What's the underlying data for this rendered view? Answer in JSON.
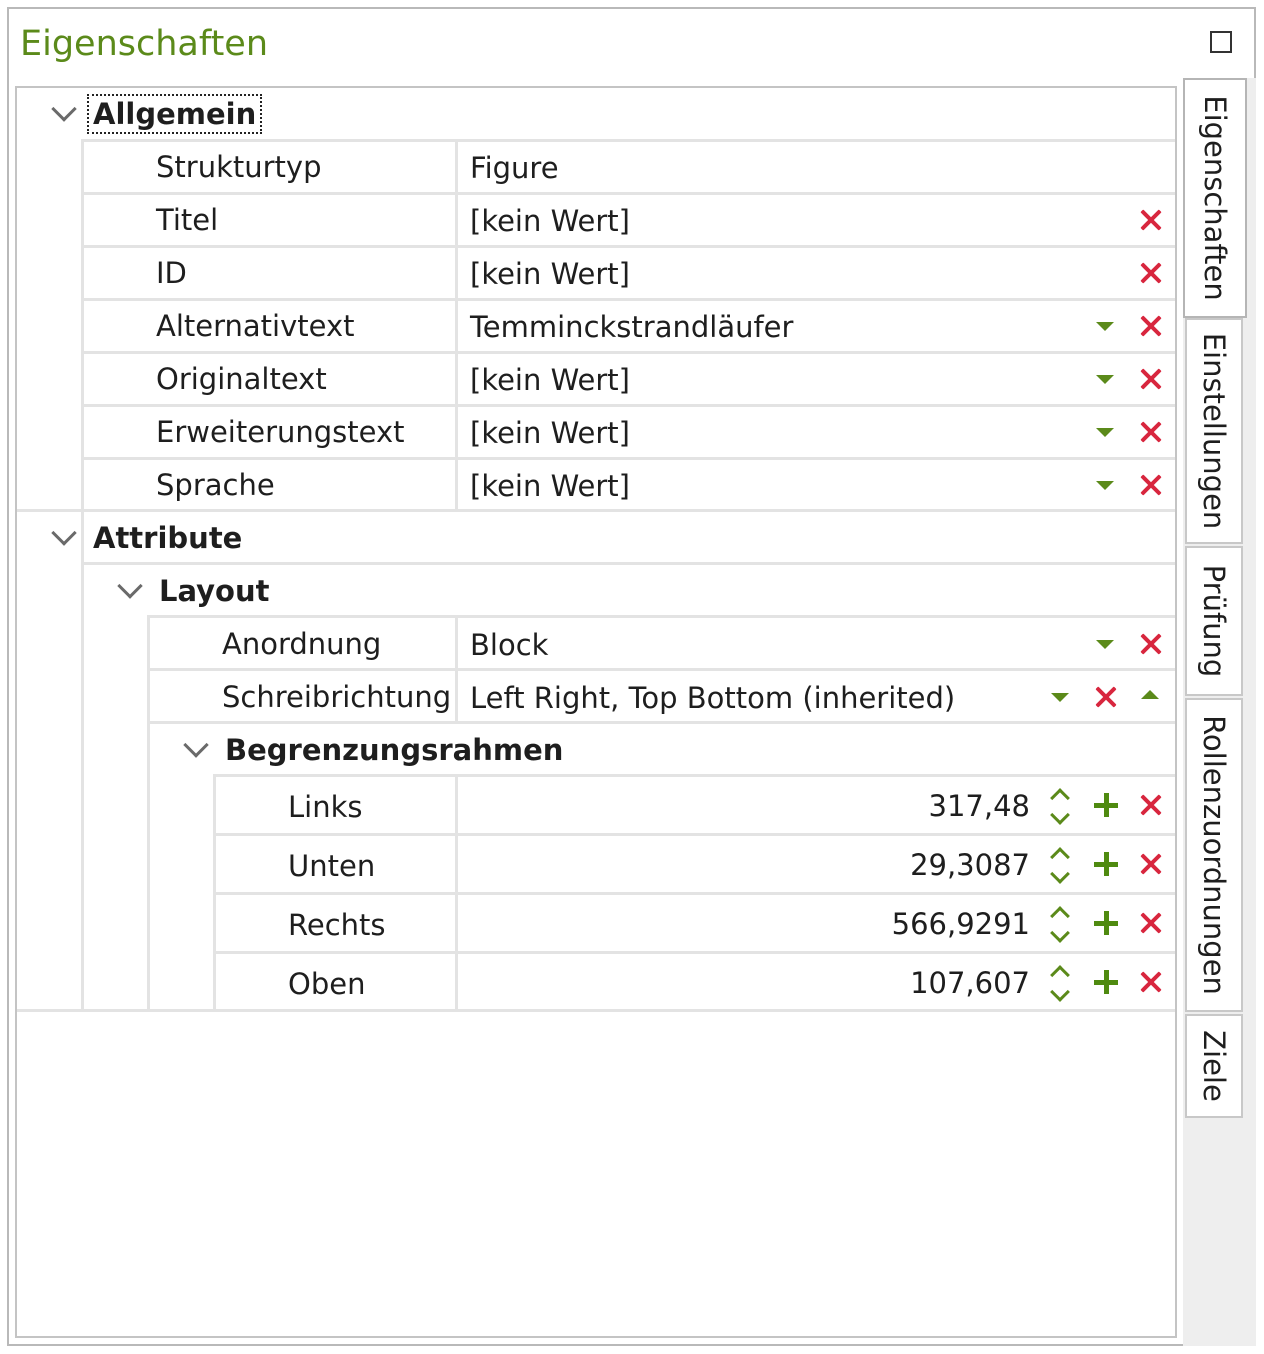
{
  "panel": {
    "title": "Eigenschaften"
  },
  "sections": {
    "allgemein": {
      "header": "Allgemein",
      "rows": [
        {
          "label": "Strukturtyp",
          "value": "Figure"
        },
        {
          "label": "Titel",
          "value": "[kein Wert]"
        },
        {
          "label": "ID",
          "value": "[kein Wert]"
        },
        {
          "label": "Alternativtext",
          "value": "Temminckstrandläufer"
        },
        {
          "label": "Originaltext",
          "value": "[kein Wert]"
        },
        {
          "label": "Erweiterungstext",
          "value": "[kein Wert]"
        },
        {
          "label": "Sprache",
          "value": "[kein Wert]"
        }
      ]
    },
    "attribute": {
      "header": "Attribute",
      "layout": {
        "header": "Layout",
        "rows": [
          {
            "label": "Anordnung",
            "value": "Block"
          },
          {
            "label": "Schreibrichtung",
            "value": "Left Right, Top Bottom (inherited)"
          }
        ],
        "bbox": {
          "header": "Begrenzungsrahmen",
          "rows": [
            {
              "label": "Links",
              "value": "317,48"
            },
            {
              "label": "Unten",
              "value": "29,3087"
            },
            {
              "label": "Rechts",
              "value": "566,9291"
            },
            {
              "label": "Oben",
              "value": "107,607"
            }
          ]
        }
      }
    }
  },
  "tabs": [
    {
      "label": "Eigenschaften",
      "active": true
    },
    {
      "label": "Einstellungen",
      "active": false
    },
    {
      "label": "Prüfung",
      "active": false
    },
    {
      "label": "Rollenzuordnungen",
      "active": false
    },
    {
      "label": "Ziele",
      "active": false
    }
  ],
  "colors": {
    "accent": "#5b8a1a",
    "delete": "#d8263e",
    "grid": "#e3e3e3"
  },
  "icons": [
    "maximize-icon",
    "chevron-down-icon",
    "dropdown-arrow-icon",
    "delete-x-icon",
    "plus-icon",
    "spinner-up-icon",
    "spinner-down-icon",
    "collapse-up-icon"
  ]
}
